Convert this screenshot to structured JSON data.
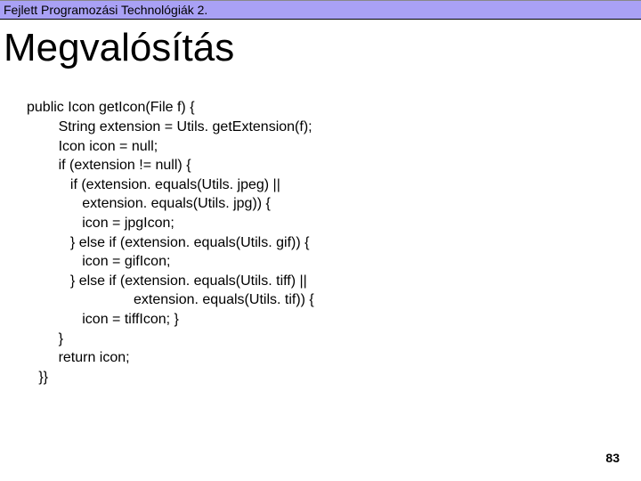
{
  "header": {
    "course_title": "Fejlett Programozási Technológiák 2."
  },
  "slide": {
    "title": "Megvalósítás",
    "code": "public Icon getIcon(File f) {\n        String extension = Utils. getExtension(f);\n        Icon icon = null;\n        if (extension != null) {\n           if (extension. equals(Utils. jpeg) ||\n              extension. equals(Utils. jpg)) {\n              icon = jpgIcon;\n           } else if (extension. equals(Utils. gif)) {\n              icon = gifIcon;\n           } else if (extension. equals(Utils. tiff) ||\n                           extension. equals(Utils. tif)) {\n              icon = tiffIcon; }\n        }\n        return icon;\n   }}",
    "page_number": "83"
  }
}
